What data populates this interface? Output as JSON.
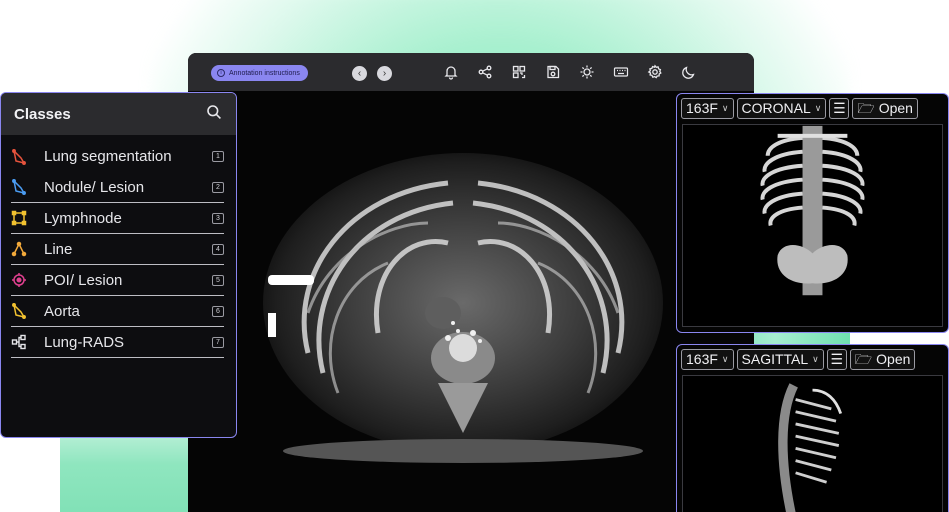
{
  "toolbar": {
    "instructions_label": "Annotation instructions",
    "icons": [
      "back-icon",
      "forward-icon",
      "bell-icon",
      "share-icon",
      "qr-grid-icon",
      "save-icon",
      "brightness-icon",
      "keyboard-icon",
      "gear-icon",
      "moon-icon"
    ]
  },
  "classes": {
    "title": "Classes",
    "items": [
      {
        "label": "Lung segmentation",
        "key": "1",
        "color": "#e5533d",
        "icon": "polygon-icon"
      },
      {
        "label": "Nodule/ Lesion",
        "key": "2",
        "color": "#4b9cf2",
        "icon": "polygon-icon"
      },
      {
        "label": "Lymphnode",
        "key": "3",
        "color": "#f2c230",
        "icon": "bbox-icon"
      },
      {
        "label": "Line",
        "key": "4",
        "color": "#f2a93b",
        "icon": "line-icon"
      },
      {
        "label": "POI/ Lesion",
        "key": "5",
        "color": "#e0408f",
        "icon": "point-icon"
      },
      {
        "label": "Aorta",
        "key": "6",
        "color": "#f2c230",
        "icon": "polygon-icon"
      },
      {
        "label": "Lung-RADS",
        "key": "7",
        "color": "#e6e6ea",
        "icon": "classification-icon"
      }
    ]
  },
  "viewports": {
    "coronal": {
      "series": "163F",
      "view": "CORONAL",
      "open_label": "Open"
    },
    "sagittal": {
      "series": "163F",
      "view": "SAGITTAL",
      "open_label": "Open"
    }
  },
  "colors": {
    "accent": "#8a86f0",
    "glow": "#7fe8b8",
    "panel": "#2b2b2e"
  }
}
